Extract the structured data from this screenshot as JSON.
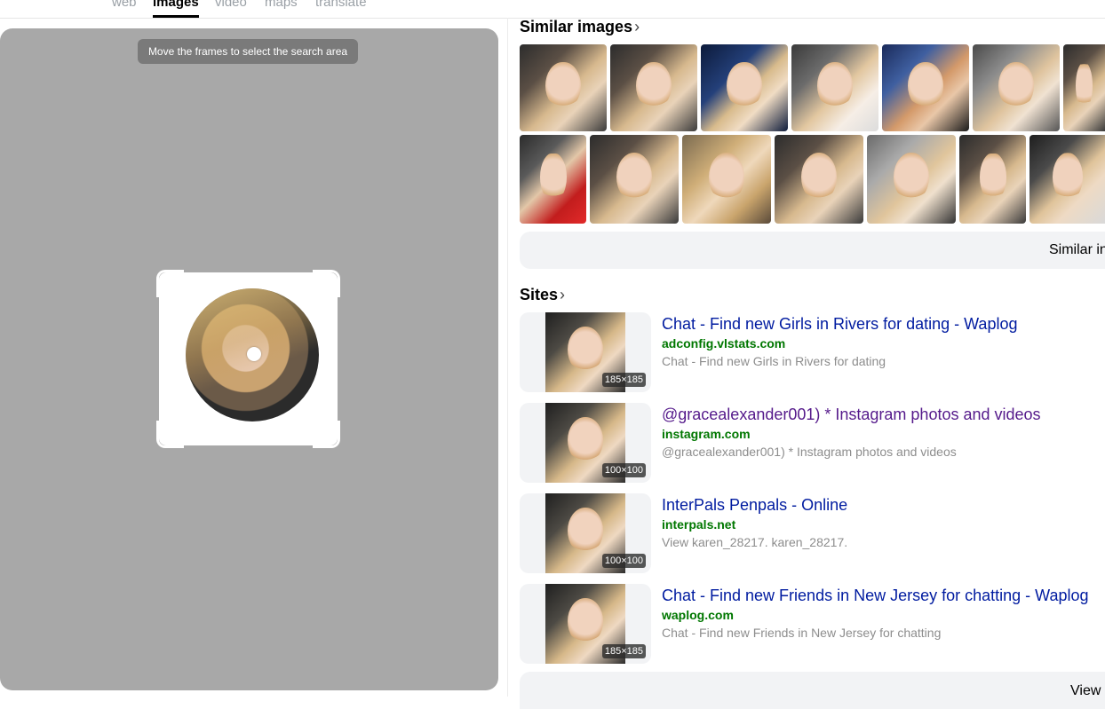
{
  "nav": {
    "tabs": [
      {
        "label": "web"
      },
      {
        "label": "images"
      },
      {
        "label": "video"
      },
      {
        "label": "maps"
      },
      {
        "label": "translate"
      }
    ]
  },
  "crop": {
    "hint": "Move the frames to select the search area"
  },
  "similar": {
    "title": "Similar images",
    "more_button": "Similar in"
  },
  "sites": {
    "title": "Sites",
    "more_button": "View",
    "items": [
      {
        "title": "Chat - Find new Girls in Rivers for dating - Waplog",
        "domain": "adconfig.vlstats.com",
        "desc": "Chat - Find new Girls in Rivers for dating",
        "size": "185×185"
      },
      {
        "title": "@gracealexander001) * Instagram photos and videos",
        "domain": "instagram.com",
        "desc": "@gracealexander001) * Instagram photos and videos",
        "size": "100×100"
      },
      {
        "title": "InterPals Penpals - Online",
        "domain": "interpals.net",
        "desc": "View karen_28217. karen_28217.",
        "size": "100×100"
      },
      {
        "title": "Chat - Find new Friends in New Jersey for chatting - Waplog",
        "domain": "waplog.com",
        "desc": "Chat - Find new Friends in New Jersey for chatting",
        "size": "185×185"
      }
    ]
  },
  "colors": {
    "link": "#001ba0",
    "visited_link": "#551a8b",
    "domain": "#007700",
    "panel_bg": "#a8a8a8"
  }
}
